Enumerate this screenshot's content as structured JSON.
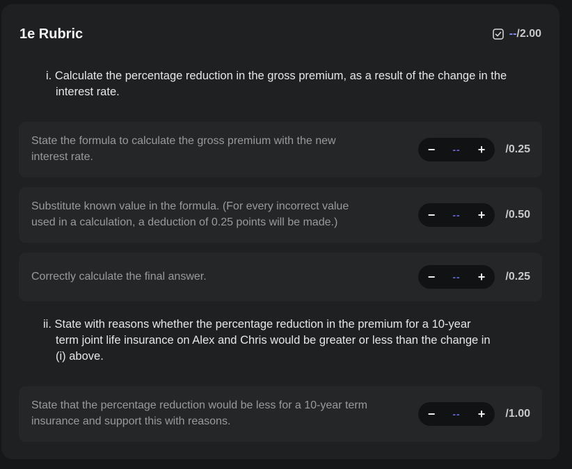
{
  "rubric": {
    "title": "1e Rubric",
    "score_current": "--",
    "score_max": "/2.00"
  },
  "questions": [
    {
      "number": "i.",
      "text_line1": "Calculate the percentage reduction in the gross premium, as a result of the change in the",
      "text_line2": "interest rate."
    },
    {
      "number": "ii.",
      "text_line1": "State with reasons whether the percentage reduction in the premium for a 10-year",
      "text_line2": "term joint life insurance on Alex and Chris would be greater or less than the change in",
      "text_line3": "(i) above."
    }
  ],
  "criteria": [
    {
      "line1": "State the formula to calculate the gross premium with the new",
      "line2": "interest rate.",
      "minus": "−",
      "value": "--",
      "plus": "+",
      "max": "/0.25"
    },
    {
      "line1": "Substitute known value in the formula. (For every incorrect value",
      "line2": "used in a calculation, a deduction of 0.25 points will be made.)",
      "minus": "−",
      "value": "--",
      "plus": "+",
      "max": "/0.50"
    },
    {
      "line1": "Correctly calculate the final answer.",
      "minus": "−",
      "value": "--",
      "plus": "+",
      "max": "/0.25"
    },
    {
      "line1": "State that the percentage reduction would be less for a 10-year term",
      "line2": "insurance and support this with reasons.",
      "minus": "−",
      "value": "--",
      "plus": "+",
      "max": "/1.00"
    }
  ]
}
